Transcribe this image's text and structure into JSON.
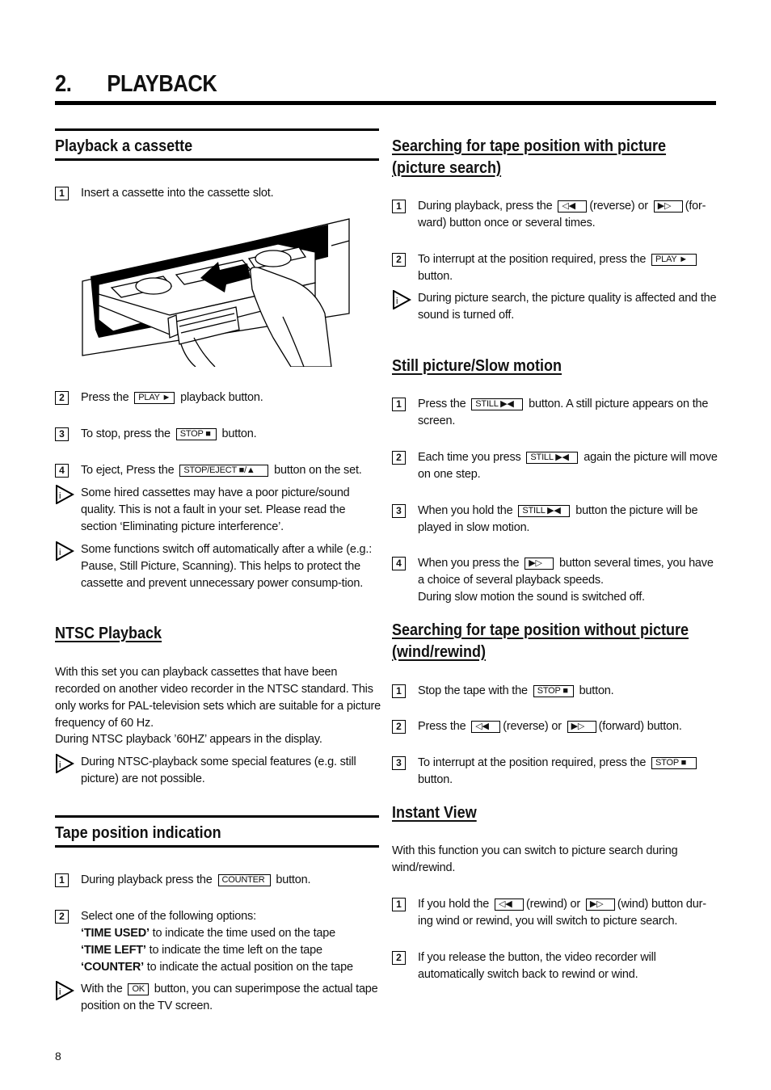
{
  "chapter": {
    "number": "2.",
    "title": "PLAYBACK"
  },
  "page_number": "8",
  "icons": {
    "info": "info-triangle-icon",
    "play": "►",
    "stop": "■",
    "eject": "▲",
    "rewind": "◁◀",
    "forward": "▶▷",
    "still": "▶◀"
  },
  "left": {
    "playback": {
      "title": "Playback a cassette",
      "step1": {
        "num": "1",
        "text": "Insert a cassette into the cassette slot."
      },
      "illustration_alt": "Hand inserting a video cassette into the cassette slot",
      "step2": {
        "num": "2",
        "pre": "Press the",
        "key": "PLAY ►",
        "post": "playback button."
      },
      "step3": {
        "num": "3",
        "pre": "To stop, press the",
        "key": "STOP ■",
        "post": "button."
      },
      "step4": {
        "num": "4",
        "pre": "To eject, Press the",
        "key": "STOP/EJECT ■/▲",
        "post": "button on the set."
      },
      "note1": "Some hired cassettes may have a poor picture/sound quality. This is not a fault in your set. Please read the section ‘Eliminating picture interference’.",
      "note2": "Some functions switch off automatically after a while (e.g.: Pause, Still Picture, Scanning). This helps to protect the cassette and prevent unnecessary power consump-tion."
    },
    "ntsc": {
      "title": "NTSC Playback",
      "para": "With this set you can playback cassettes that have been recorded on another video recorder in the NTSC standard. This only works for PAL-television sets which are suitable for a picture frequency of 60 Hz.",
      "para2": "During NTSC playback ’60HZ’ appears in the display.",
      "note": "During NTSC-playback some special features (e.g. still picture) are not possible."
    },
    "tape": {
      "title": "Tape position indication",
      "step1": {
        "num": "1",
        "pre": "During playback press the",
        "key": "COUNTER",
        "post": "button."
      },
      "step2": {
        "num": "2",
        "intro": "Select one of the following options:",
        "options": [
          {
            "label": "‘TIME USED’",
            "desc": "to indicate the time used on the tape"
          },
          {
            "label": "‘TIME LEFT’",
            "desc": "to indicate the time left on the tape"
          },
          {
            "label": "‘COUNTER’",
            "desc": "to indicate the actual position on the tape"
          }
        ]
      },
      "note": {
        "pre": "With the",
        "key": "OK",
        "post": "button, you can superimpose the actual tape position on the TV screen."
      }
    }
  },
  "right": {
    "picture_search": {
      "title": "Searching for tape position with picture (picture search)",
      "step1": {
        "num": "1",
        "pre": "During playback, press the",
        "key1": "◁◀",
        "mid": "(reverse) or",
        "key2": "▶▷",
        "post": "(for-ward) button once or several times."
      },
      "step2": {
        "num": "2",
        "pre": "To interrupt at the position required, press the",
        "key": "PLAY ►",
        "post": "button."
      },
      "note": "During picture search, the picture quality is affected and the sound is turned off."
    },
    "still": {
      "title": "Still picture/Slow motion",
      "step1": {
        "num": "1",
        "pre": "Press the",
        "key": "STILL ▶◀",
        "post": "button. A still picture appears on the screen."
      },
      "step2": {
        "num": "2",
        "pre": "Each time you press",
        "key": "STILL ▶◀",
        "post": "again the picture will move on one step."
      },
      "step3": {
        "num": "3",
        "pre": "When you hold the",
        "key": "STILL ▶◀",
        "post": "button the picture will be played in slow motion."
      },
      "step4": {
        "num": "4",
        "pre": "When you press the",
        "key": "▶▷",
        "post": "button several times, you have a choice of several playback speeds.",
        "extra": "During slow motion the sound is switched off."
      }
    },
    "wind": {
      "title": "Searching for tape position without picture (wind/rewind)",
      "step1": {
        "num": "1",
        "pre": "Stop the tape with the",
        "key": "STOP ■",
        "post": "button."
      },
      "step2": {
        "num": "2",
        "pre": "Press the",
        "key1": "◁◀",
        "mid": "(reverse) or",
        "key2": "▶▷",
        "post": "(forward) button."
      },
      "step3": {
        "num": "3",
        "pre": "To interrupt at the position required, press the",
        "key": "STOP ■",
        "post": "button."
      }
    },
    "instant": {
      "title": "Instant View",
      "para": "With this function you can switch to picture search during wind/rewind.",
      "step1": {
        "num": "1",
        "pre": "If you hold the",
        "key1": "◁◀",
        "mid": "(rewind) or",
        "key2": "▶▷",
        "post": "(wind) button dur-ing wind or rewind, you will switch to picture search."
      },
      "step2": {
        "num": "2",
        "text": "If you release the button, the video recorder will automatically switch back to rewind or wind."
      }
    }
  }
}
